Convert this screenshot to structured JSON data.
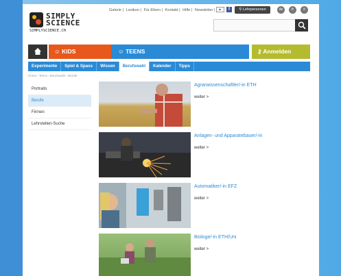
{
  "logo": {
    "word1": "SIMPLY",
    "word2": "SCIENCE",
    "url": "SIMPLYSCIENCE.CH"
  },
  "topnav": {
    "items": [
      "Galerie |",
      "Lexikon |",
      "Für Eltern |",
      "Kontakt |",
      "Hilfe |",
      "Newsletter |"
    ]
  },
  "header": {
    "login_label": "Lehrpersonen",
    "lang": [
      "de",
      "fr",
      "it"
    ],
    "search_placeholder": ""
  },
  "main_nav": {
    "kids": "KIDS",
    "teens": "TEENS",
    "anmelden": "Anmelden"
  },
  "sub_nav": {
    "items": [
      "Experimente",
      "Spiel & Spass",
      "Wissen",
      "Berufswahl",
      "Kalender",
      "Tipps"
    ],
    "active": "Berufswahl"
  },
  "breadcrumb": "Home › Teens › Berufswahl › Berufe",
  "left_menu": {
    "items": [
      "Portraits",
      "Berufe",
      "Firmen",
      "Lehrstellen-Suche"
    ],
    "active": "Berufe"
  },
  "items": [
    {
      "title": "Agrarwissenschaftler/-in ETH",
      "more": "weiter >"
    },
    {
      "title": "Anlagen- und Apparatebauer/-in",
      "more": "weiter >"
    },
    {
      "title": "Automatiker/-in EFZ",
      "more": "weiter >"
    },
    {
      "title": "Biologe/-in ETH/Uni",
      "more": "weiter >"
    }
  ],
  "colors": {
    "accent": "#2a8ad6",
    "kids": "#e8581c",
    "anmelden": "#b4bb2e"
  }
}
